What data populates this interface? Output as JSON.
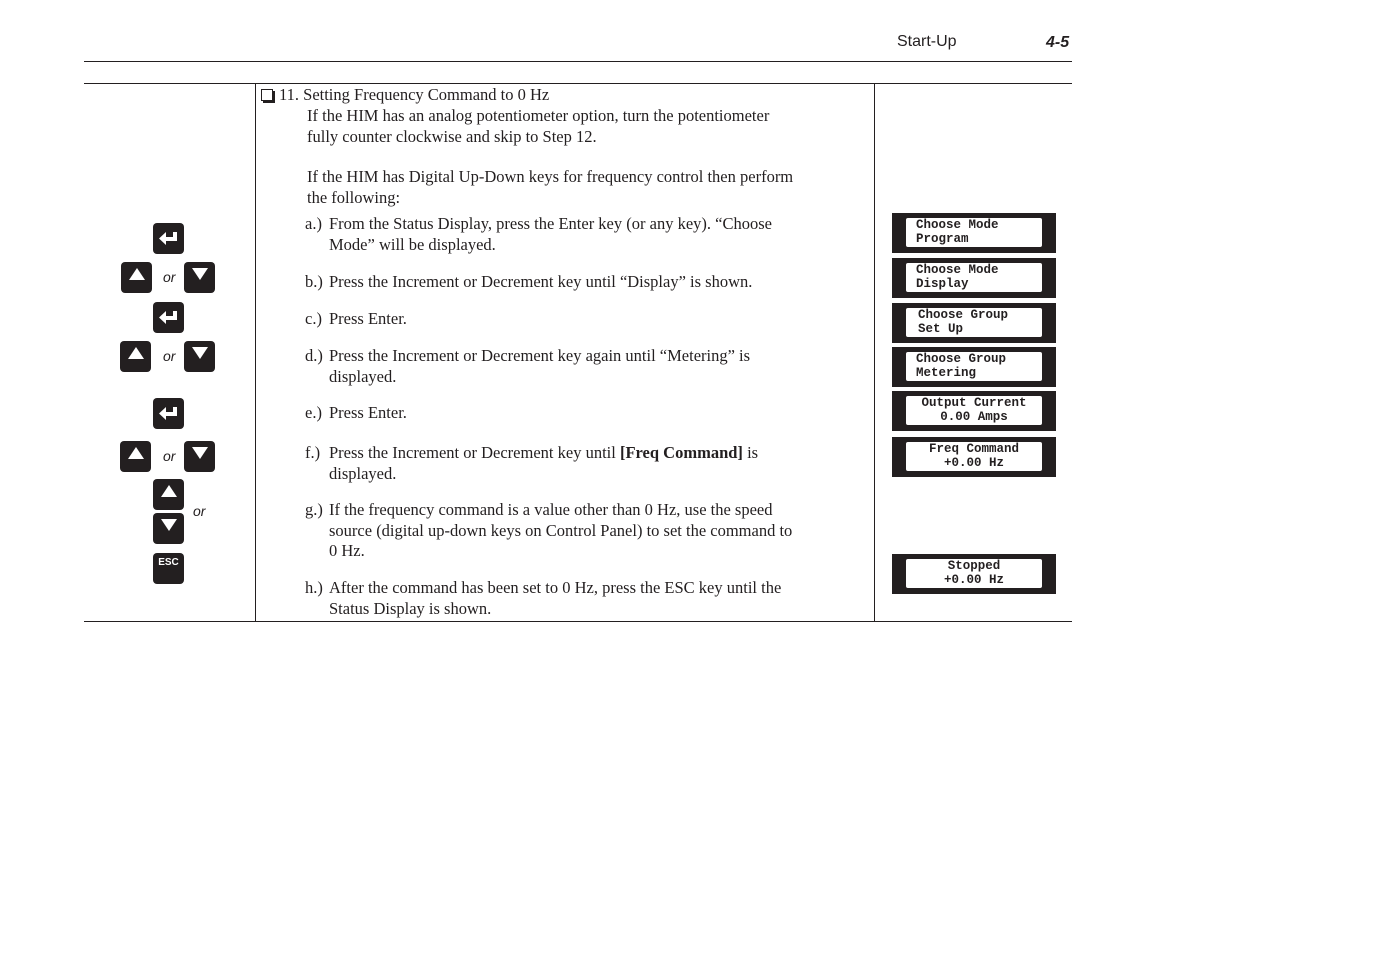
{
  "header": {
    "section": "Start-Up",
    "page": "4-5"
  },
  "step": {
    "number": "11.",
    "title": "Setting Frequency Command to 0 Hz",
    "intro1": [
      "If the HIM has an analog potentiometer option, turn the potentiometer",
      "fully counter clockwise and skip to Step 12."
    ],
    "intro2": [
      "If the HIM has Digital Up-Down keys for frequency control then perform",
      "the following:"
    ],
    "substeps": [
      {
        "label": "a.)",
        "lines": [
          "From the Status Display, press the Enter key (or any key).  “Choose",
          "Mode” will be displayed."
        ]
      },
      {
        "label": "b.)",
        "lines": [
          "Press the Increment or Decrement key until “Display” is shown."
        ]
      },
      {
        "label": "c.)",
        "lines": [
          "Press Enter."
        ]
      },
      {
        "label": "d.)",
        "lines": [
          "Press the Increment or Decrement key again until “Metering” is",
          "displayed."
        ]
      },
      {
        "label": "e.)",
        "lines": [
          "Press Enter."
        ]
      },
      {
        "label": "f.)",
        "pre": "Press the Increment or Decrement key until ",
        "bold": "[Freq Command]",
        "post": " is",
        "line2": "displayed."
      },
      {
        "label": "g.)",
        "lines": [
          "If the frequency command is a value other than 0 Hz, use the speed",
          "source (digital up-down keys on Control Panel) to set the command to",
          "0 Hz."
        ]
      },
      {
        "label": "h.)",
        "lines": [
          "After the command has been set to 0 Hz, press the ESC key until the",
          "Status Display is shown."
        ]
      }
    ]
  },
  "keys": {
    "or": "or",
    "esc": "ESC"
  },
  "displays": [
    {
      "line1": "Choose Mode",
      "line2": "Program"
    },
    {
      "line1": "Choose Mode",
      "line2": "Display"
    },
    {
      "line1": "Choose Group",
      "line2": "Set Up"
    },
    {
      "line1": "Choose Group",
      "line2": "Metering"
    },
    {
      "line1": "Output Current",
      "line2": "0.00 Amps"
    },
    {
      "line1": "Freq Command",
      "line2": "+0.00 Hz"
    },
    {
      "line1": "Stopped",
      "line2": "+0.00 Hz"
    }
  ]
}
